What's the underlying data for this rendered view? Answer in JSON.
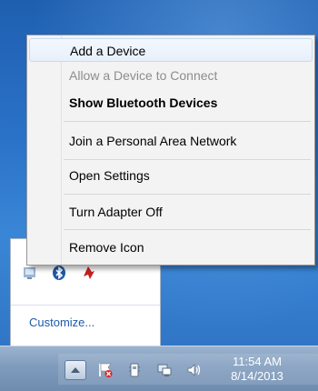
{
  "context_menu": {
    "items": [
      {
        "label": "Add a Device",
        "state": "hover"
      },
      {
        "label": "Allow a Device to Connect",
        "state": "disabled"
      },
      {
        "label": "Show Bluetooth Devices",
        "state": "bold"
      },
      {
        "label": "Join a Personal Area Network",
        "state": "normal"
      },
      {
        "label": "Open Settings",
        "state": "normal"
      },
      {
        "label": "Turn Adapter Off",
        "state": "normal"
      },
      {
        "label": "Remove Icon",
        "state": "normal"
      }
    ]
  },
  "overflow_panel": {
    "customize_label": "Customize...",
    "icons": [
      "network-tray-icon",
      "bluetooth-icon",
      "red-app-icon"
    ]
  },
  "taskbar": {
    "tray_icons": [
      "show-hidden-icons-button",
      "action-center-flag-icon",
      "power-icon",
      "network-icon",
      "volume-icon"
    ],
    "clock": {
      "time": "11:54 AM",
      "date": "8/14/2013"
    }
  },
  "colors": {
    "link": "#1e5aa8",
    "menu_bg": "#f3f3f3",
    "hover_border": "#c8dbf2"
  }
}
